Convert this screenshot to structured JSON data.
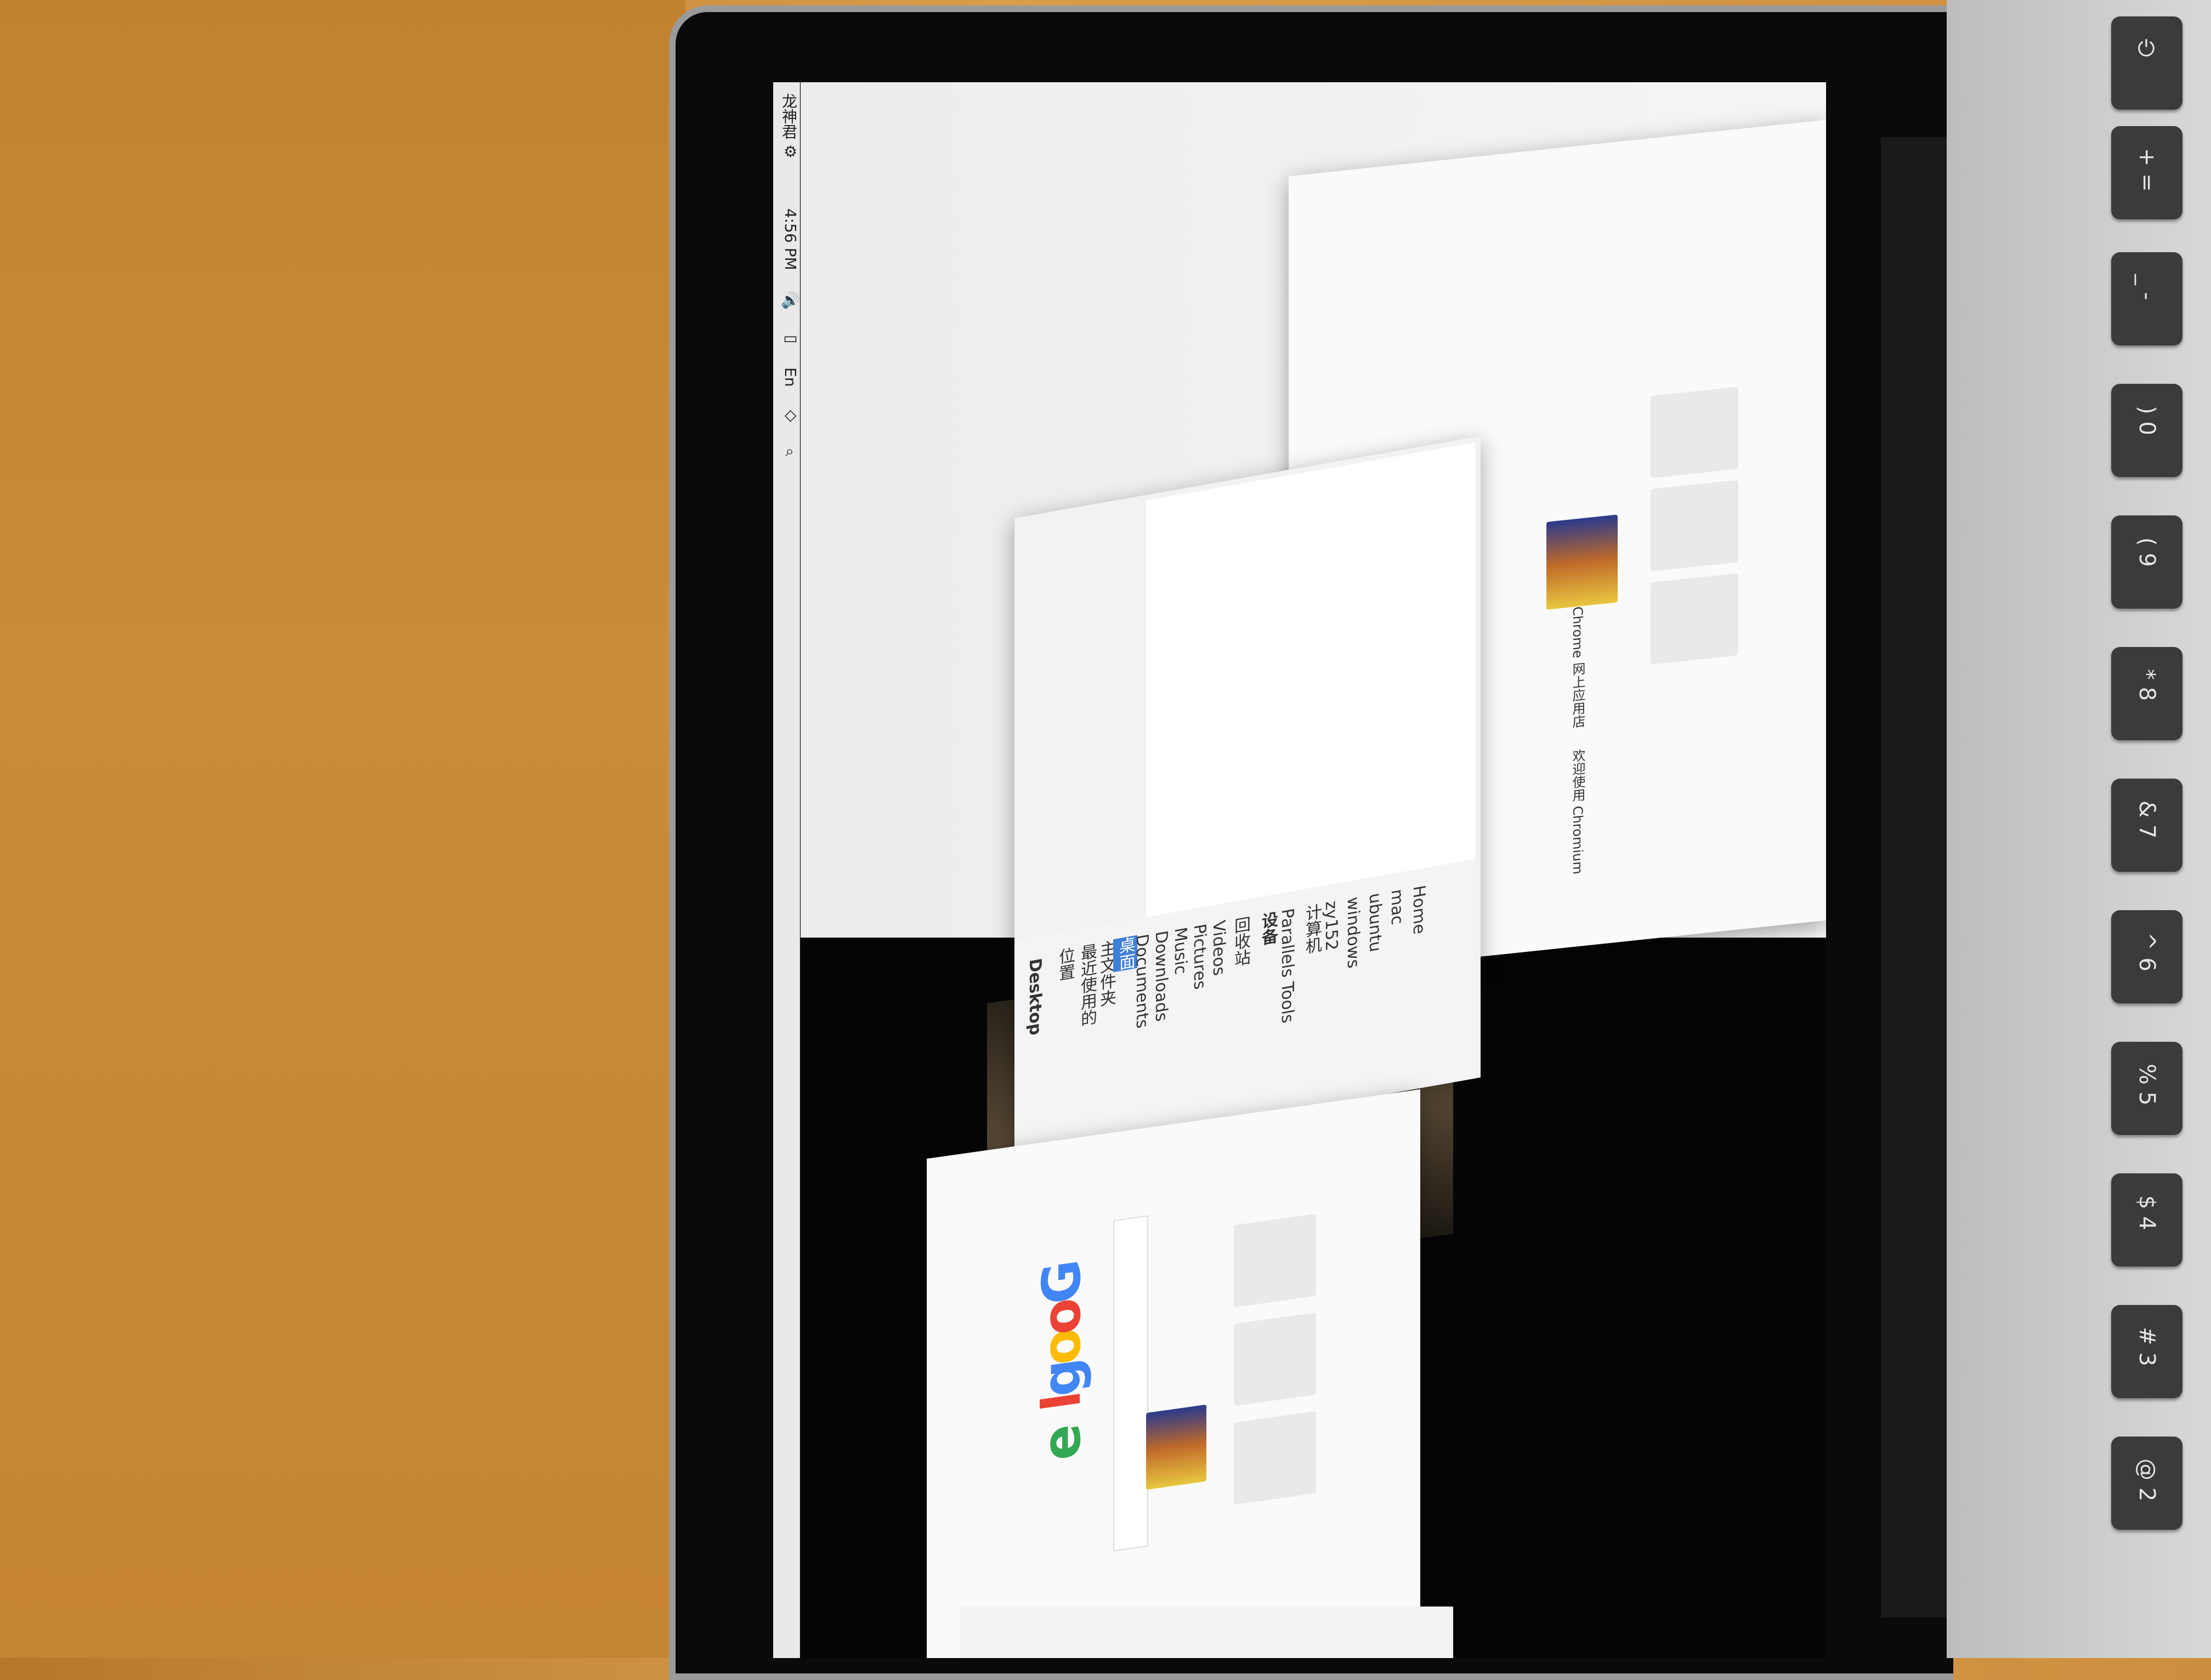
{
  "menubar": {
    "user": "龙神君",
    "time": "4:56 PM",
    "input_method": "En"
  },
  "files": {
    "title": "Desktop",
    "places_header": "位置",
    "places": [
      "最近使用的",
      "主文件夹",
      "桌面",
      "Documents",
      "Downloads",
      "Music",
      "Pictures",
      "Videos",
      "回收站"
    ],
    "devices_header": "设备",
    "devices": [
      "Parallels Tools",
      "计算机",
      "zy152",
      "windows",
      "ubuntu",
      "mac",
      "Home"
    ]
  },
  "chrome": {
    "tile_label_1": "Chrome 网上应用店",
    "tile_label_2": "欢迎使用 Chromium",
    "logo_letters": [
      "G",
      "o",
      "o",
      "g",
      "l",
      "e"
    ]
  },
  "keyboard": {
    "keys": [
      "⏻",
      "+ =",
      "_ -",
      ") 0",
      "( 9",
      "* 8",
      "& 7",
      "^ 6",
      "% 5",
      "$ 4",
      "# 3",
      "@ 2"
    ]
  }
}
